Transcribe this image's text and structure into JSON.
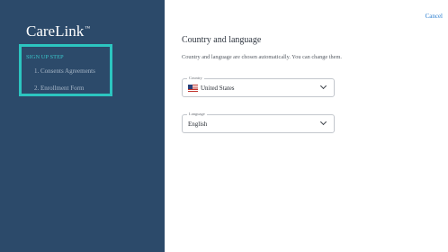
{
  "brand": {
    "name": "CareLink",
    "tm": "™"
  },
  "signup": {
    "title": "SIGN UP STEP",
    "steps": [
      {
        "label": "1. Consents Agreements"
      },
      {
        "label": "2. Enrollment Form"
      }
    ]
  },
  "header": {
    "cancel_label": "Cancel"
  },
  "main": {
    "heading": "Country and language",
    "description": "Country and language are chosen automatically. You can change them.",
    "country": {
      "label": "Country",
      "value": "United States",
      "icon": "us-flag-icon"
    },
    "language": {
      "label": "Language",
      "value": "English"
    }
  },
  "colors": {
    "sidebar_bg": "#2c4a6a",
    "highlight_border": "#2cc5c0",
    "steps_title": "#39c3c9",
    "link": "#2d7fd0"
  }
}
